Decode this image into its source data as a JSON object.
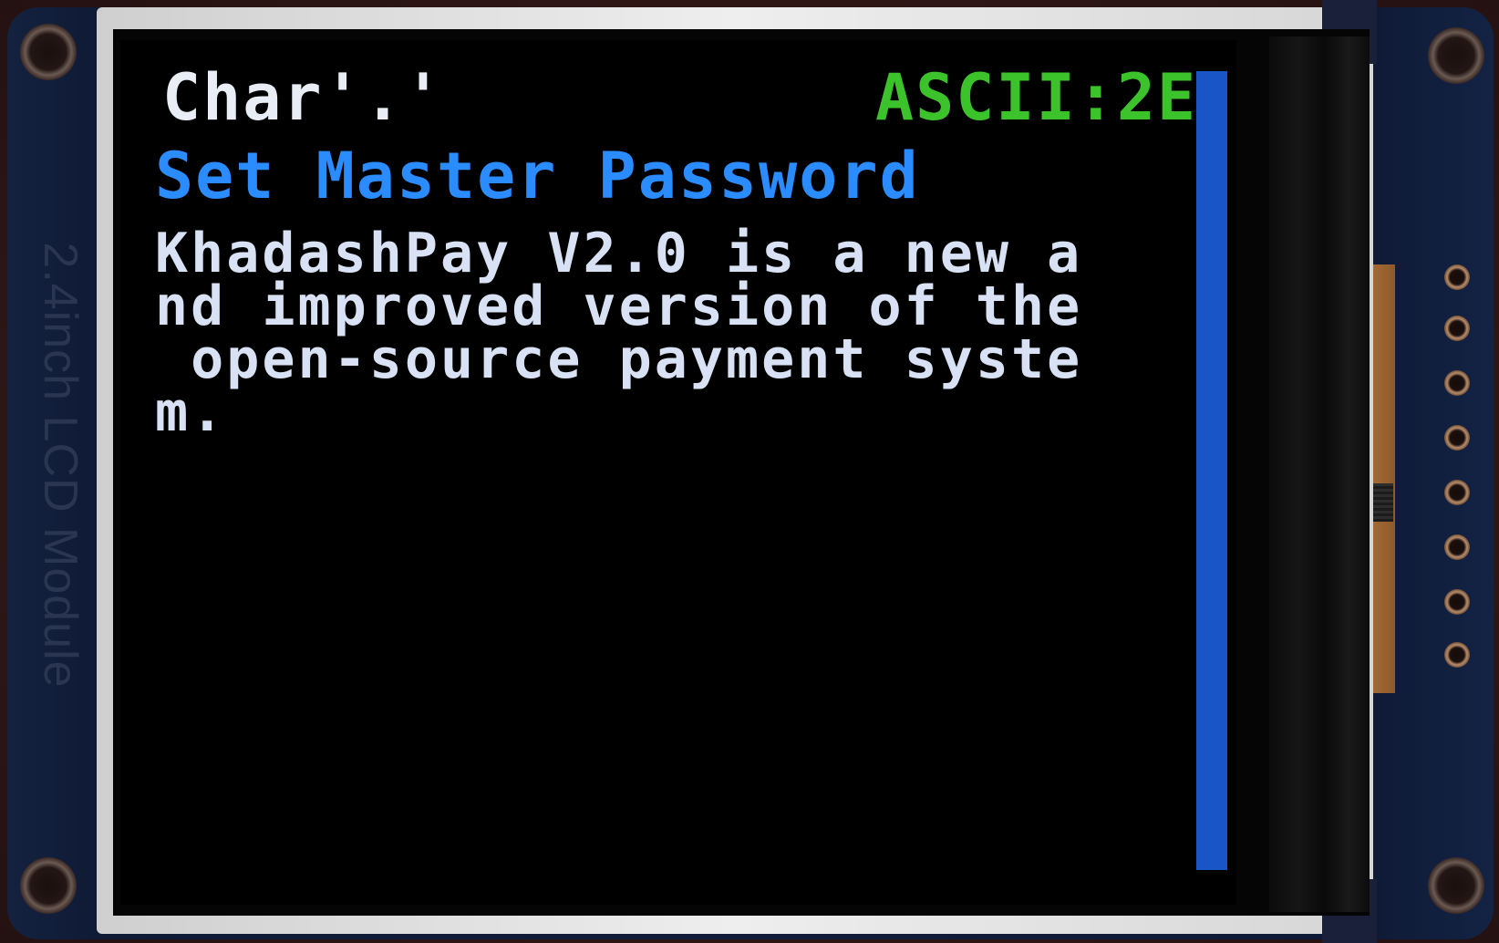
{
  "board": {
    "silkscreen_label": "2.4inch LCD Module"
  },
  "screen": {
    "char_label": "Char'.'",
    "ascii_label": "ASCII:2E",
    "title": "Set Master Password",
    "body_lines": [
      "KhadashPay V2.0 is a new a",
      "nd improved version of the",
      " open-source payment syste",
      "m."
    ]
  },
  "colors": {
    "char_label": "#e9eef6",
    "ascii_label": "#3cc22a",
    "title": "#2a8cff",
    "body": "#d8e2f4",
    "scrollbar": "#1a55c8",
    "background": "#000000"
  }
}
